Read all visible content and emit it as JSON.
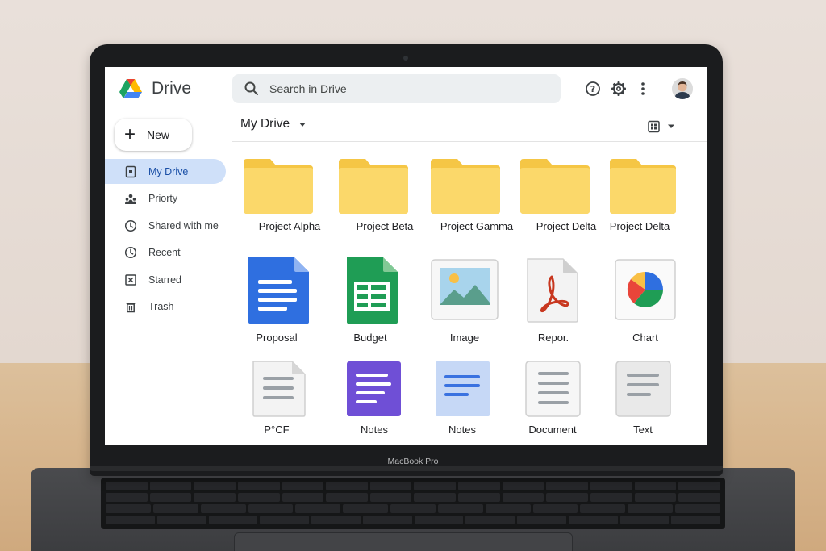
{
  "device": {
    "label": "MacBook Pro"
  },
  "app": {
    "title": "Drive"
  },
  "search": {
    "placeholder": "Search in Drive"
  },
  "toolbar": {
    "icons": [
      "help-icon",
      "settings-icon",
      "more-icon",
      "avatar"
    ]
  },
  "sidebar": {
    "new_label": "New",
    "items": [
      {
        "label": "My Drive",
        "icon": "drive-icon",
        "active": true
      },
      {
        "label": "Priorty",
        "icon": "people-icon",
        "active": false
      },
      {
        "label": "Shared with me",
        "icon": "clock-icon",
        "active": false
      },
      {
        "label": "Recent",
        "icon": "clock-icon",
        "active": false
      },
      {
        "label": "Starred",
        "icon": "box-x-icon",
        "active": false
      },
      {
        "label": "Trash",
        "icon": "trash-icon",
        "active": false
      }
    ]
  },
  "main": {
    "title": "My Drive",
    "folders": [
      {
        "name": "Project Alpha"
      },
      {
        "name": "Project Beta"
      },
      {
        "name": "Project Gamma"
      },
      {
        "name": "Project Delta"
      },
      {
        "name": "Project Delta"
      }
    ],
    "files_row1": [
      {
        "name": "Proposal",
        "kind": "doc"
      },
      {
        "name": "Budget",
        "kind": "sheet"
      },
      {
        "name": "Image",
        "kind": "image"
      },
      {
        "name": "Repor.",
        "kind": "pdf"
      },
      {
        "name": "Chart",
        "kind": "chart"
      }
    ],
    "files_row2": [
      {
        "name": "P°CF",
        "kind": "generic"
      },
      {
        "name": "Notes",
        "kind": "notes-purple"
      },
      {
        "name": "Notes",
        "kind": "notes-blue"
      },
      {
        "name": "Document",
        "kind": "document"
      },
      {
        "name": "Text",
        "kind": "text"
      }
    ]
  },
  "colors": {
    "folder": "#fbd86a",
    "doc_blue": "#2f6fe0",
    "sheet_green": "#1f9d55",
    "active_nav": "#cfe0f9",
    "notes_purple": "#6f4fd6"
  }
}
